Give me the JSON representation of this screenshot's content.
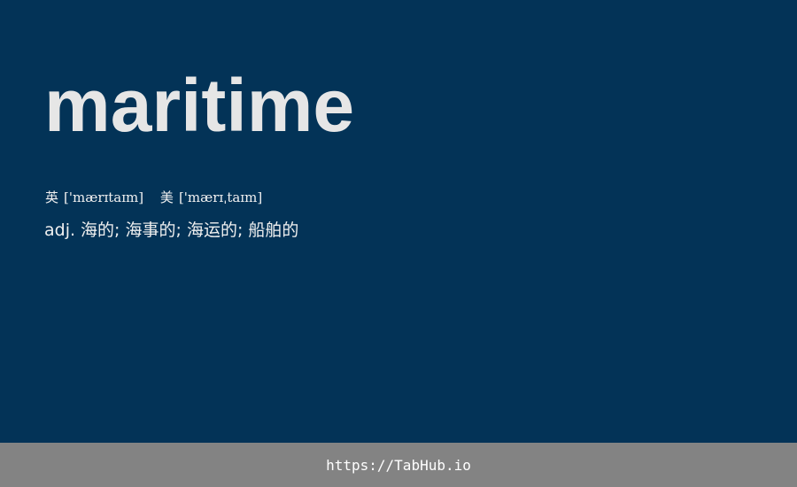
{
  "entry": {
    "word": "maritime",
    "phonetics": [
      {
        "label": "英",
        "value": "['mærɪtaɪm]"
      },
      {
        "label": "美",
        "value": "['mærɪˌtaɪm]"
      }
    ],
    "definition": "adj. 海的; 海事的; 海运的; 船舶的"
  },
  "footer": {
    "link_text": "https://TabHub.io"
  },
  "colors": {
    "background": "#033357",
    "footer_background": "#838383",
    "text": "#e6e6e6"
  }
}
